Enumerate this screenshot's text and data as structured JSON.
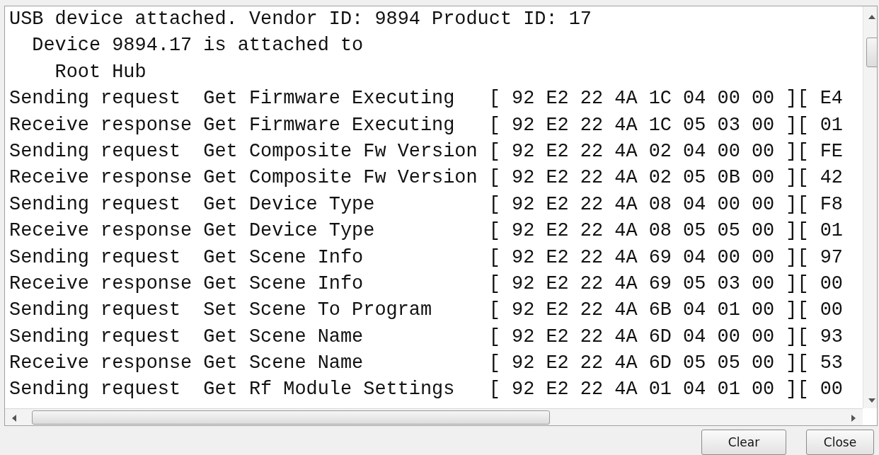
{
  "log": {
    "header": {
      "text": "USB device attached. Vendor ID: 9894 Product ID: 17",
      "children": [
        {
          "text": "Device 9894.17 is attached to",
          "children": [
            {
              "text": "Root Hub"
            }
          ]
        }
      ]
    },
    "rows": [
      {
        "direction": "Sending request",
        "command": "Get Firmware Executing",
        "bytes": "[ 92 E2 22 4A 1C 04 00 00 ][ E4"
      },
      {
        "direction": "Receive response",
        "command": "Get Firmware Executing",
        "bytes": "[ 92 E2 22 4A 1C 05 03 00 ][ 01"
      },
      {
        "direction": "Sending request",
        "command": "Get Composite Fw Version",
        "bytes": "[ 92 E2 22 4A 02 04 00 00 ][ FE"
      },
      {
        "direction": "Receive response",
        "command": "Get Composite Fw Version",
        "bytes": "[ 92 E2 22 4A 02 05 0B 00 ][ 42"
      },
      {
        "direction": "Sending request",
        "command": "Get Device Type",
        "bytes": "[ 92 E2 22 4A 08 04 00 00 ][ F8"
      },
      {
        "direction": "Receive response",
        "command": "Get Device Type",
        "bytes": "[ 92 E2 22 4A 08 05 05 00 ][ 01"
      },
      {
        "direction": "Sending request",
        "command": "Get Scene Info",
        "bytes": "[ 92 E2 22 4A 69 04 00 00 ][ 97"
      },
      {
        "direction": "Receive response",
        "command": "Get Scene Info",
        "bytes": "[ 92 E2 22 4A 69 05 03 00 ][ 00"
      },
      {
        "direction": "Sending request",
        "command": "Set Scene To Program",
        "bytes": "[ 92 E2 22 4A 6B 04 01 00 ][ 00"
      },
      {
        "direction": "Sending request",
        "command": "Get Scene Name",
        "bytes": "[ 92 E2 22 4A 6D 04 00 00 ][ 93"
      },
      {
        "direction": "Receive response",
        "command": "Get Scene Name",
        "bytes": "[ 92 E2 22 4A 6D 05 05 00 ][ 53"
      },
      {
        "direction": "Sending request",
        "command": "Get Rf Module Settings",
        "bytes": "[ 92 E2 22 4A 01 04 01 00 ][ 00"
      }
    ]
  },
  "buttons": [
    "Clear",
    "Close"
  ]
}
